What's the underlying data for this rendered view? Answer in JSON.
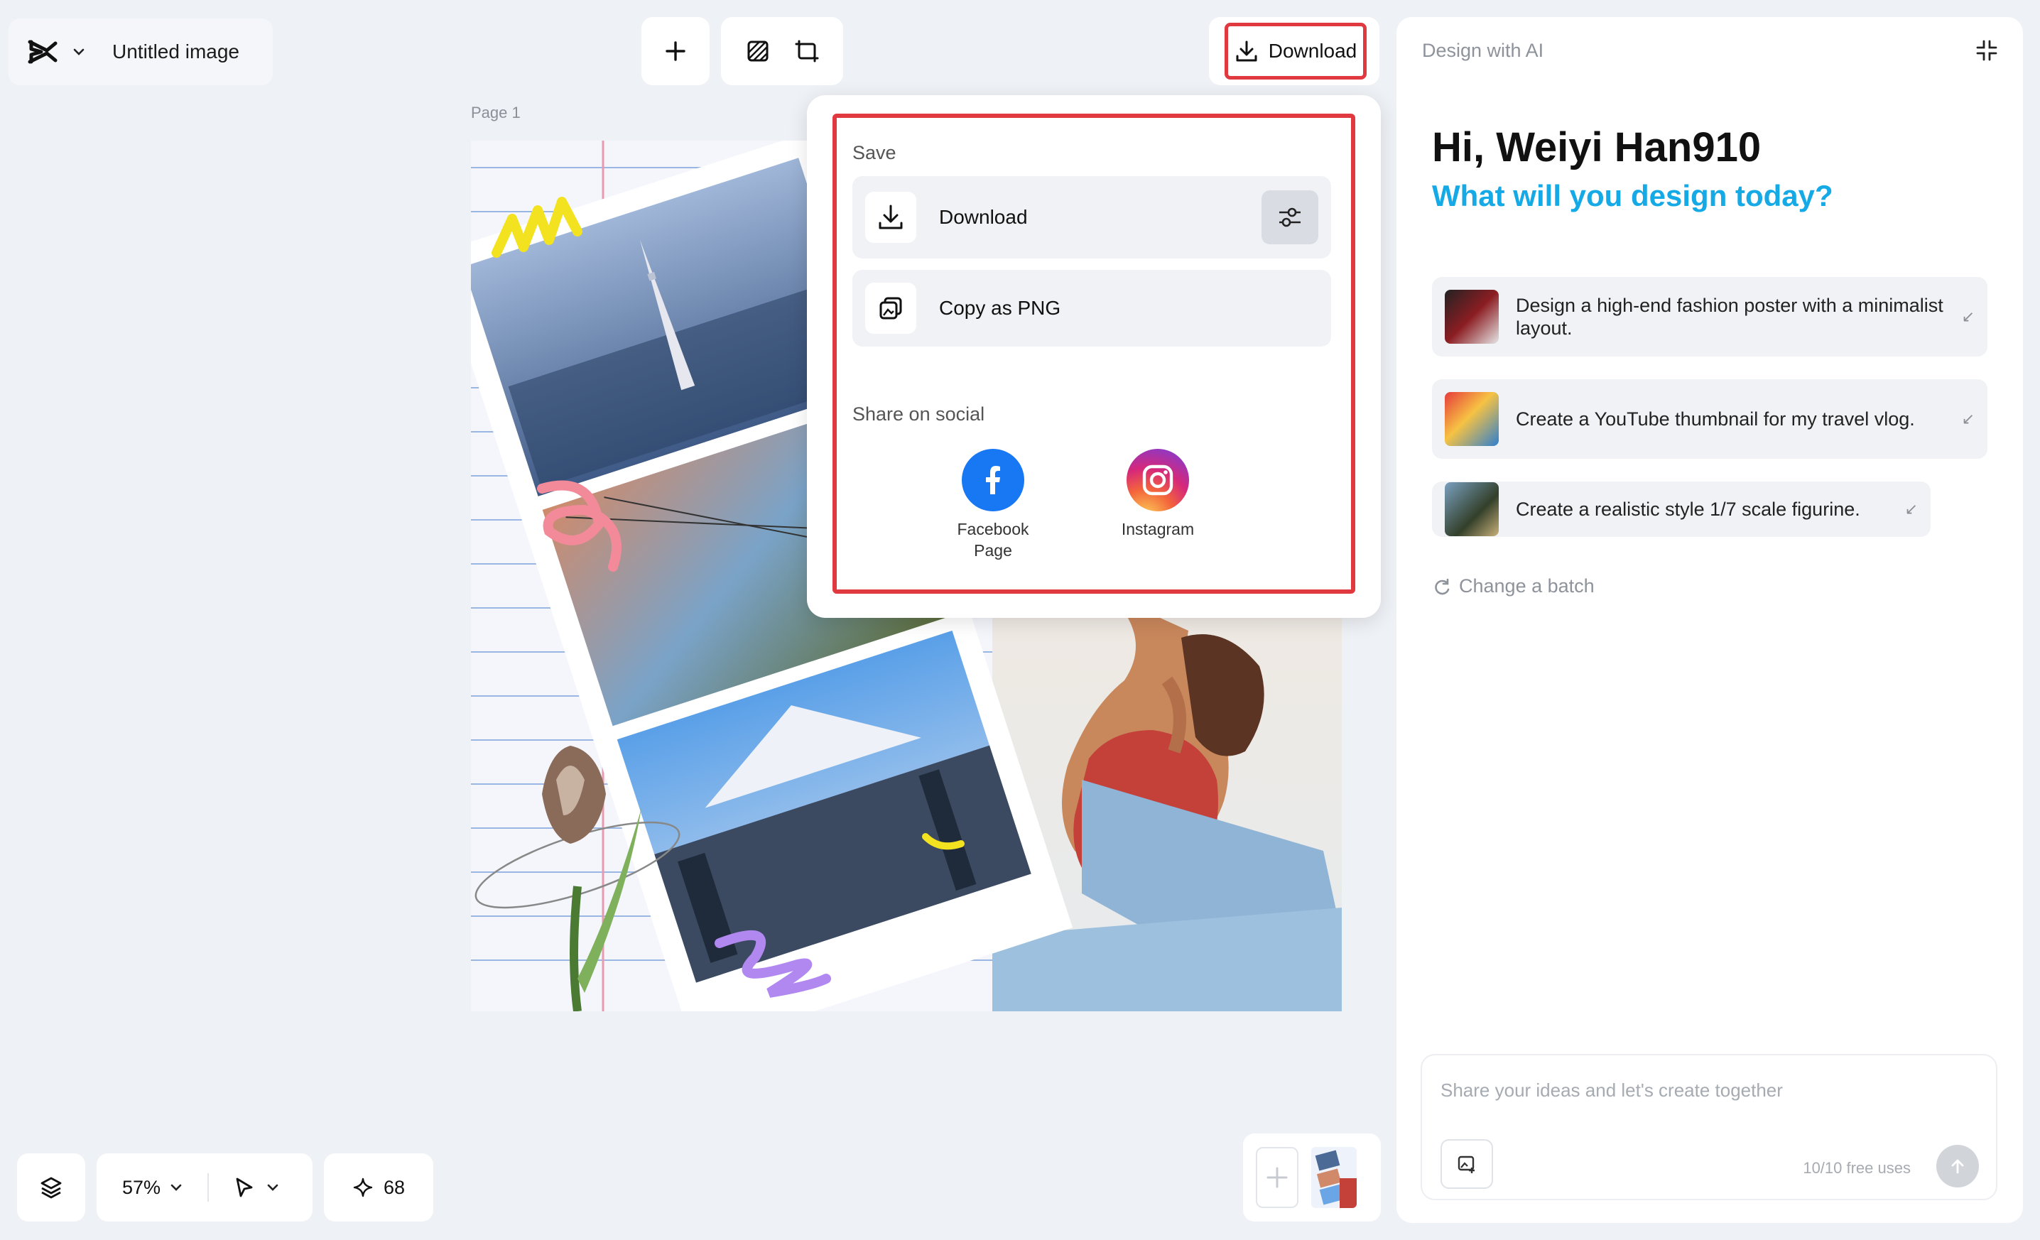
{
  "header": {
    "doc_title": "Untitled image",
    "download_label": "Download"
  },
  "canvas": {
    "page_label": "Page 1"
  },
  "download_menu": {
    "save_heading": "Save",
    "download_label": "Download",
    "copy_label": "Copy as PNG",
    "share_heading": "Share on social",
    "social": [
      {
        "label": "Facebook Page",
        "icon": "facebook-icon",
        "color": "#1877f2"
      },
      {
        "label": "Instagram",
        "icon": "instagram-icon",
        "color": "#dd2a7b"
      }
    ]
  },
  "ai_panel": {
    "title": "Design with AI",
    "greeting": "Hi, Weiyi Han910",
    "subtitle": "What will you design today?",
    "prompts": [
      "Design a high-end fashion poster with a minimalist layout.",
      "Create a YouTube thumbnail for my travel vlog.",
      "Create a realistic style 1/7 scale figurine."
    ],
    "change_batch": "Change a batch",
    "input_placeholder": "Share your ideas and let's create together",
    "uses": "10/10 free uses"
  },
  "bottom_bar": {
    "zoom": "57%",
    "credits": "68"
  },
  "colors": {
    "accent_blue": "#15a9e6",
    "highlight_red": "#e0393f",
    "background": "#eef1f5"
  }
}
